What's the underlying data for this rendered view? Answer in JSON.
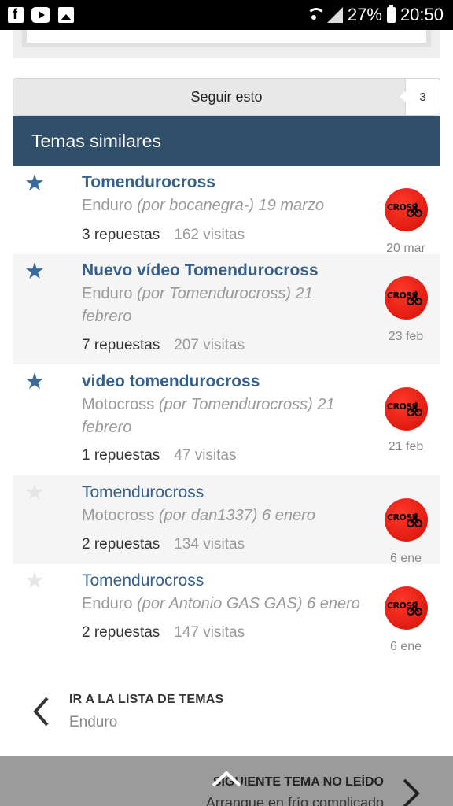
{
  "status_bar": {
    "battery": "27%",
    "time": "20:50",
    "left_icons": [
      "facebook-icon",
      "youtube-icon",
      "gallery-icon"
    ]
  },
  "follow": {
    "label": "Seguir esto",
    "count": "3"
  },
  "section": {
    "title": "Temas similares"
  },
  "threads": [
    {
      "starred": true,
      "title": "Tomendurocross",
      "bold": true,
      "forum": "Enduro",
      "author_text": "(por bocanegra-)",
      "date_text": "19 marzo",
      "replies": "3 repuestas",
      "views": "162 visitas",
      "short_date": "20 mar"
    },
    {
      "starred": true,
      "title": "Nuevo vídeo Tomendurocross",
      "bold": true,
      "forum": "Enduro",
      "author_text": "(por Tomendurocross)",
      "date_text": "21 febrero",
      "replies": "7 repuestas",
      "views": "207 visitas",
      "short_date": "23 feb"
    },
    {
      "starred": true,
      "title": "video tomendurocross",
      "bold": true,
      "forum": "Motocross",
      "author_text": "(por Tomendurocross)",
      "date_text": "21 febrero",
      "replies": "1 repuestas",
      "views": "47 visitas",
      "short_date": "21 feb"
    },
    {
      "starred": false,
      "title": "Tomendurocross",
      "bold": false,
      "forum": "Motocross",
      "author_text": "(por dan1337)",
      "date_text": "6 enero",
      "replies": "2 repuestas",
      "views": "134 visitas",
      "short_date": "6 ene"
    },
    {
      "starred": false,
      "title": "Tomendurocross",
      "bold": false,
      "forum": "Enduro",
      "author_text": "(por Antonio GAS GAS)",
      "date_text": "6 enero",
      "replies": "2 repuestas",
      "views": "147 visitas",
      "short_date": "6 ene"
    }
  ],
  "avatar": {
    "logo_text": "CROSS"
  },
  "back_link": {
    "title": "IR A LA LISTA DE TEMAS",
    "subtitle": "Enduro"
  },
  "next_unread": {
    "title": "SIGUIENTE TEMA NO LEÍDO",
    "subtitle": "Arranque en frío complicado"
  },
  "colors": {
    "header_bg": "#2f4f6b",
    "link": "#36608a",
    "star_active": "#3b6a99",
    "star_inactive": "#e6e6e6",
    "avatar_red": "#e01b10",
    "bottom_bar": "#9b9b9b"
  }
}
